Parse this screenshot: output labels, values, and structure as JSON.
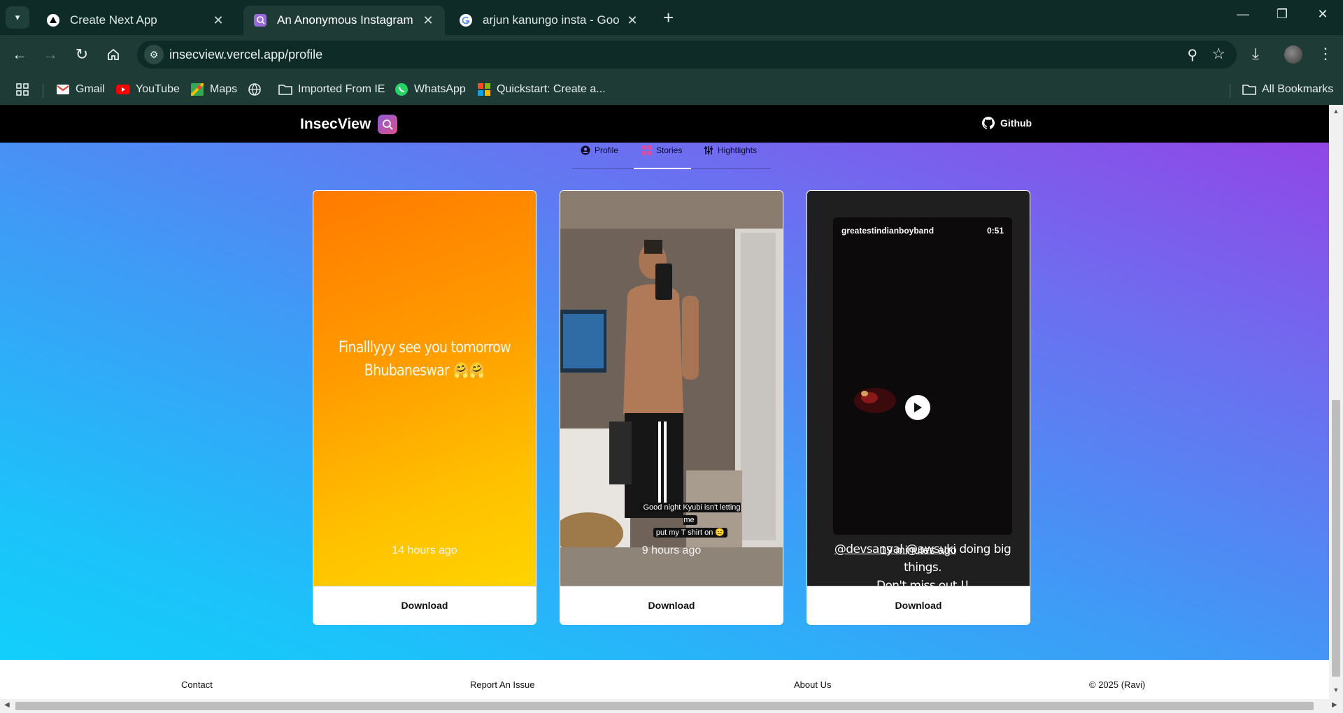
{
  "browser": {
    "tabs": [
      {
        "title": "Create Next App"
      },
      {
        "title": "An Anonymous Instagram Profile"
      },
      {
        "title": "arjun kanungo insta - Google Search"
      }
    ],
    "url": "insecview.vercel.app/profile",
    "bookmarks": [
      "Gmail",
      "YouTube",
      "Maps",
      "Imported From IE",
      "WhatsApp",
      "Quickstart: Create a...",
      "All Bookmarks"
    ]
  },
  "site": {
    "brand": "InsecView",
    "github_label": "Github"
  },
  "profile_tabs": [
    "Profile",
    "Stories",
    "Hightlights"
  ],
  "stories": [
    {
      "text_line1": "Finalllyyy see you tomorrow",
      "text_line2": "Bhubaneswar 🤗🤗",
      "time": "14 hours ago",
      "download_label": "Download"
    },
    {
      "caption_line1": "Good night Kyubi isn't letting me",
      "caption_line2": "put my T shirt on 😑",
      "time": "9 hours ago",
      "download_label": "Download"
    },
    {
      "video_user": "greatestindianboyband",
      "video_duration": "0:51",
      "caption_mentions": "@devsanyal @awsuki",
      "caption_rest": " doing big things.",
      "caption_line2": "Don't miss out !!",
      "time": "19 minutes ago",
      "download_label": "Download"
    }
  ],
  "footer": {
    "contact": "Contact",
    "report": "Report An Issue",
    "about": "About Us",
    "copyright": "© 2025 (Ravi)"
  }
}
